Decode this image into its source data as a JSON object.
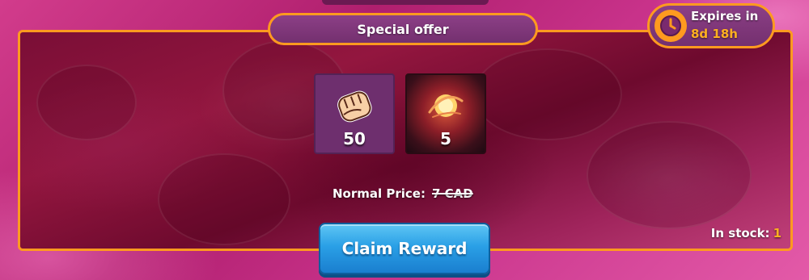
{
  "offer": {
    "title": "Special offer",
    "expires_label": "Expires in",
    "expires_value": "8d 18h",
    "items": [
      {
        "icon": "fist-icon",
        "count": "50"
      },
      {
        "icon": "fire-orb-icon",
        "count": "5"
      }
    ],
    "normal_price_label": "Normal Price:",
    "normal_price_value": "7 CAD",
    "stock_label": "In stock:",
    "stock_value": "1",
    "claim_label": "Claim Reward"
  },
  "colors": {
    "accent_orange": "#ff9a1f",
    "pill_purple": "#7f3679",
    "button_blue": "#2aa0e6",
    "highlight_yellow": "#ffb020"
  }
}
